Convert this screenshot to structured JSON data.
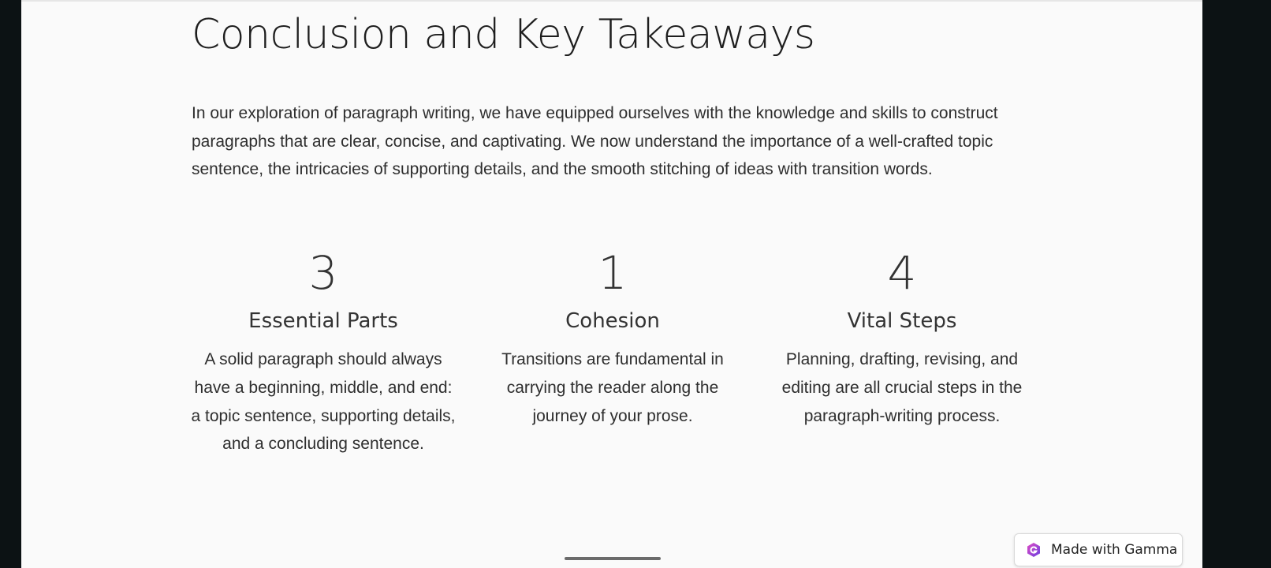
{
  "slide": {
    "title": "Conclusion and Key Takeaways",
    "intro": "In our exploration of paragraph writing, we have equipped ourselves with the knowledge and skills to construct paragraphs that are clear, concise, and captivating. We now understand the importance of a well-crafted topic sentence, the intricacies of supporting details, and the smooth stitching of ideas with transition words.",
    "stats": [
      {
        "number": "3",
        "label": "Essential Parts",
        "description": "A solid paragraph should always have a beginning, middle, and end: a topic sentence, supporting details, and a concluding sentence."
      },
      {
        "number": "1",
        "label": "Cohesion",
        "description": "Transitions are fundamental in carrying the reader along the journey of your prose."
      },
      {
        "number": "4",
        "label": "Vital Steps",
        "description": "Planning, drafting, revising, and editing are all crucial steps in the paragraph-writing process."
      }
    ]
  },
  "badge": {
    "label": "Made with Gamma",
    "icon": "gamma-logo-icon",
    "icon_color": "#7b3fe4"
  },
  "colors": {
    "page_background": "#0c1214",
    "slide_background": "#fafafa",
    "heading_text": "#1e1e1e",
    "body_text": "#2e2e2e"
  }
}
